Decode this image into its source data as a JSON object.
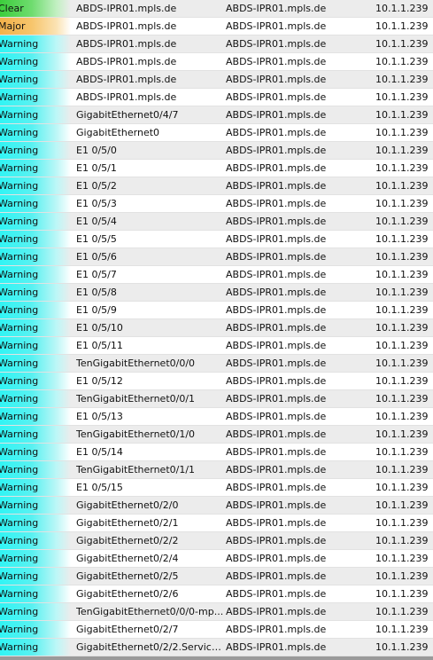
{
  "rows": [
    {
      "severity": "Clear",
      "severity_class": "clear",
      "object": "ABDS-IPR01.mpls.de",
      "device": "ABDS-IPR01.mpls.de",
      "ip": "10.1.1.239"
    },
    {
      "severity": "Major",
      "severity_class": "major",
      "object": "ABDS-IPR01.mpls.de",
      "device": "ABDS-IPR01.mpls.de",
      "ip": "10.1.1.239"
    },
    {
      "severity": "Warning",
      "severity_class": "warning",
      "object": "ABDS-IPR01.mpls.de",
      "device": "ABDS-IPR01.mpls.de",
      "ip": "10.1.1.239"
    },
    {
      "severity": "Warning",
      "severity_class": "warning",
      "object": "ABDS-IPR01.mpls.de",
      "device": "ABDS-IPR01.mpls.de",
      "ip": "10.1.1.239"
    },
    {
      "severity": "Warning",
      "severity_class": "warning",
      "object": "ABDS-IPR01.mpls.de",
      "device": "ABDS-IPR01.mpls.de",
      "ip": "10.1.1.239"
    },
    {
      "severity": "Warning",
      "severity_class": "warning",
      "object": "ABDS-IPR01.mpls.de",
      "device": "ABDS-IPR01.mpls.de",
      "ip": "10.1.1.239"
    },
    {
      "severity": "Warning",
      "severity_class": "warning",
      "object": "GigabitEthernet0/4/7",
      "device": "ABDS-IPR01.mpls.de",
      "ip": "10.1.1.239"
    },
    {
      "severity": "Warning",
      "severity_class": "warning",
      "object": "GigabitEthernet0",
      "device": "ABDS-IPR01.mpls.de",
      "ip": "10.1.1.239"
    },
    {
      "severity": "Warning",
      "severity_class": "warning",
      "object": "E1 0/5/0",
      "device": "ABDS-IPR01.mpls.de",
      "ip": "10.1.1.239"
    },
    {
      "severity": "Warning",
      "severity_class": "warning",
      "object": "E1 0/5/1",
      "device": "ABDS-IPR01.mpls.de",
      "ip": "10.1.1.239"
    },
    {
      "severity": "Warning",
      "severity_class": "warning",
      "object": "E1 0/5/2",
      "device": "ABDS-IPR01.mpls.de",
      "ip": "10.1.1.239"
    },
    {
      "severity": "Warning",
      "severity_class": "warning",
      "object": "E1 0/5/3",
      "device": "ABDS-IPR01.mpls.de",
      "ip": "10.1.1.239"
    },
    {
      "severity": "Warning",
      "severity_class": "warning",
      "object": "E1 0/5/4",
      "device": "ABDS-IPR01.mpls.de",
      "ip": "10.1.1.239"
    },
    {
      "severity": "Warning",
      "severity_class": "warning",
      "object": "E1 0/5/5",
      "device": "ABDS-IPR01.mpls.de",
      "ip": "10.1.1.239"
    },
    {
      "severity": "Warning",
      "severity_class": "warning",
      "object": "E1 0/5/6",
      "device": "ABDS-IPR01.mpls.de",
      "ip": "10.1.1.239"
    },
    {
      "severity": "Warning",
      "severity_class": "warning",
      "object": "E1 0/5/7",
      "device": "ABDS-IPR01.mpls.de",
      "ip": "10.1.1.239"
    },
    {
      "severity": "Warning",
      "severity_class": "warning",
      "object": "E1 0/5/8",
      "device": "ABDS-IPR01.mpls.de",
      "ip": "10.1.1.239"
    },
    {
      "severity": "Warning",
      "severity_class": "warning",
      "object": "E1 0/5/9",
      "device": "ABDS-IPR01.mpls.de",
      "ip": "10.1.1.239"
    },
    {
      "severity": "Warning",
      "severity_class": "warning",
      "object": "E1 0/5/10",
      "device": "ABDS-IPR01.mpls.de",
      "ip": "10.1.1.239"
    },
    {
      "severity": "Warning",
      "severity_class": "warning",
      "object": "E1 0/5/11",
      "device": "ABDS-IPR01.mpls.de",
      "ip": "10.1.1.239"
    },
    {
      "severity": "Warning",
      "severity_class": "warning",
      "object": "TenGigabitEthernet0/0/0",
      "device": "ABDS-IPR01.mpls.de",
      "ip": "10.1.1.239"
    },
    {
      "severity": "Warning",
      "severity_class": "warning",
      "object": "E1 0/5/12",
      "device": "ABDS-IPR01.mpls.de",
      "ip": "10.1.1.239"
    },
    {
      "severity": "Warning",
      "severity_class": "warning",
      "object": "TenGigabitEthernet0/0/1",
      "device": "ABDS-IPR01.mpls.de",
      "ip": "10.1.1.239"
    },
    {
      "severity": "Warning",
      "severity_class": "warning",
      "object": "E1 0/5/13",
      "device": "ABDS-IPR01.mpls.de",
      "ip": "10.1.1.239"
    },
    {
      "severity": "Warning",
      "severity_class": "warning",
      "object": "TenGigabitEthernet0/1/0",
      "device": "ABDS-IPR01.mpls.de",
      "ip": "10.1.1.239"
    },
    {
      "severity": "Warning",
      "severity_class": "warning",
      "object": "E1 0/5/14",
      "device": "ABDS-IPR01.mpls.de",
      "ip": "10.1.1.239"
    },
    {
      "severity": "Warning",
      "severity_class": "warning",
      "object": "TenGigabitEthernet0/1/1",
      "device": "ABDS-IPR01.mpls.de",
      "ip": "10.1.1.239"
    },
    {
      "severity": "Warning",
      "severity_class": "warning",
      "object": "E1 0/5/15",
      "device": "ABDS-IPR01.mpls.de",
      "ip": "10.1.1.239"
    },
    {
      "severity": "Warning",
      "severity_class": "warning",
      "object": "GigabitEthernet0/2/0",
      "device": "ABDS-IPR01.mpls.de",
      "ip": "10.1.1.239"
    },
    {
      "severity": "Warning",
      "severity_class": "warning",
      "object": "GigabitEthernet0/2/1",
      "device": "ABDS-IPR01.mpls.de",
      "ip": "10.1.1.239"
    },
    {
      "severity": "Warning",
      "severity_class": "warning",
      "object": "GigabitEthernet0/2/2",
      "device": "ABDS-IPR01.mpls.de",
      "ip": "10.1.1.239"
    },
    {
      "severity": "Warning",
      "severity_class": "warning",
      "object": "GigabitEthernet0/2/4",
      "device": "ABDS-IPR01.mpls.de",
      "ip": "10.1.1.239"
    },
    {
      "severity": "Warning",
      "severity_class": "warning",
      "object": "GigabitEthernet0/2/5",
      "device": "ABDS-IPR01.mpls.de",
      "ip": "10.1.1.239"
    },
    {
      "severity": "Warning",
      "severity_class": "warning",
      "object": "GigabitEthernet0/2/6",
      "device": "ABDS-IPR01.mpls.de",
      "ip": "10.1.1.239"
    },
    {
      "severity": "Warning",
      "severity_class": "warning",
      "object": "TenGigabitEthernet0/0/0-mp...",
      "device": "ABDS-IPR01.mpls.de",
      "ip": "10.1.1.239"
    },
    {
      "severity": "Warning",
      "severity_class": "warning",
      "object": "GigabitEthernet0/2/7",
      "device": "ABDS-IPR01.mpls.de",
      "ip": "10.1.1.239"
    },
    {
      "severity": "Warning",
      "severity_class": "warning",
      "object": "GigabitEthernet0/2/2.Service...",
      "device": "ABDS-IPR01.mpls.de",
      "ip": "10.1.1.239"
    }
  ],
  "colors": {
    "warning": "#31f4f4",
    "major": "#f3b24a",
    "clear": "#3ccd3c",
    "row_alt": "#ececec"
  }
}
